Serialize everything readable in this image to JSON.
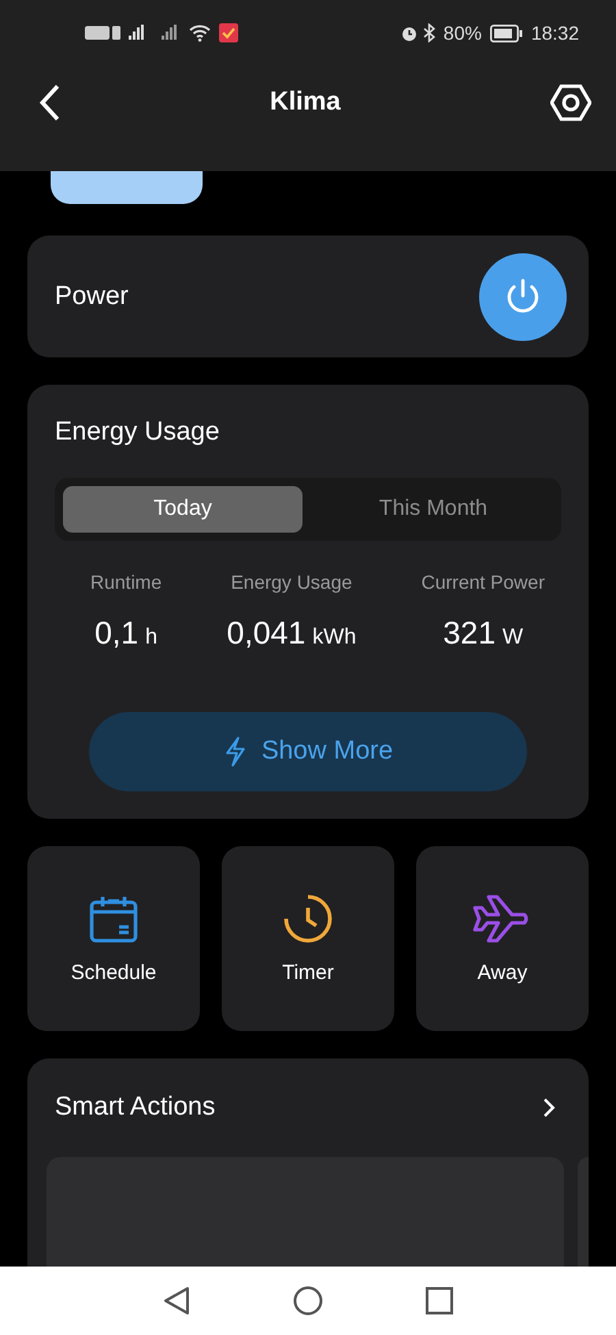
{
  "status_bar": {
    "battery": "80%",
    "time": "18:32"
  },
  "header": {
    "title": "Klima"
  },
  "power": {
    "label": "Power",
    "on": true
  },
  "energy": {
    "title": "Energy Usage",
    "tabs": [
      {
        "label": "Today",
        "selected": true
      },
      {
        "label": "This Month",
        "selected": false
      }
    ],
    "stats": [
      {
        "label": "Runtime",
        "value": "0,1",
        "unit": "h"
      },
      {
        "label": "Energy Usage",
        "value": "0,041",
        "unit": "kWh"
      },
      {
        "label": "Current Power",
        "value": "321",
        "unit": "W"
      }
    ],
    "button": "Show More"
  },
  "tiles": [
    {
      "kind": "schedule",
      "label": "Schedule",
      "color": "#2f8fe0"
    },
    {
      "kind": "timer",
      "label": "Timer",
      "color": "#f0a73a"
    },
    {
      "kind": "away",
      "label": "Away",
      "color": "#9a4fe6"
    }
  ],
  "smart_actions": {
    "title": "Smart Actions"
  }
}
